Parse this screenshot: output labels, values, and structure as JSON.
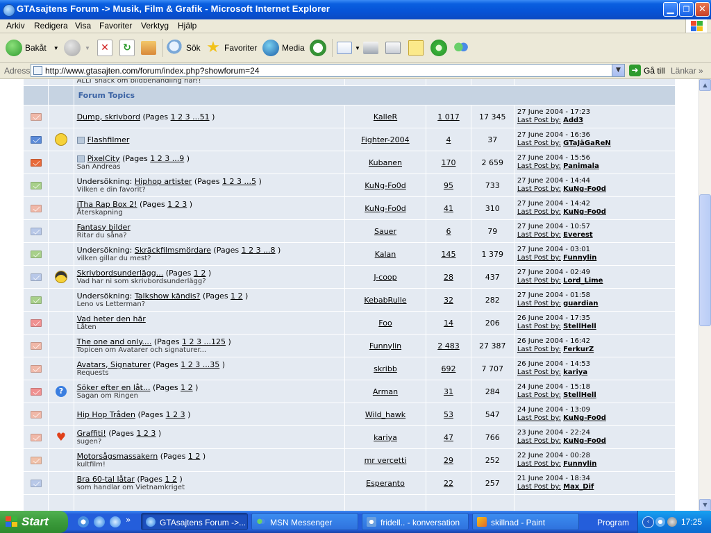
{
  "window": {
    "title": "GTAsajtens Forum -> Musik, Film & Grafik - Microsoft Internet Explorer"
  },
  "menu": [
    "Arkiv",
    "Redigera",
    "Visa",
    "Favoriter",
    "Verktyg",
    "Hjälp"
  ],
  "toolbar": {
    "back": "Bakåt",
    "search": "Sök",
    "favorites": "Favoriter",
    "media": "Media"
  },
  "address": {
    "label": "Adress",
    "url": "http://www.gtasajten.com/forum/index.php?showforum=24",
    "go": "Gå till",
    "links": "Länkar"
  },
  "partial_row": {
    "desc": "ALLT snack om bildbehandling här!!"
  },
  "section": {
    "title": "Forum Topics"
  },
  "topics": [
    {
      "icon_color": "#f0b8a8",
      "emoticon": "",
      "prefix": "",
      "title": "Dump, skrivbord",
      "pages_label": "(Pages",
      "pages": "1 2 3 ...51",
      "desc": "",
      "author": "KalleR",
      "replies": "1 017",
      "views": "17 345",
      "date": "27 June 2004 - 17:23",
      "lp_label": "Last Post by:",
      "lp_user": "Add3"
    },
    {
      "icon_color": "#5a8ad8",
      "emoticon": "smile",
      "prefix": "",
      "title": "Flashfilmer",
      "pages_label": "",
      "pages": "",
      "desc": "",
      "author": "Fighter-2004",
      "replies": "4",
      "views": "37",
      "date": "27 June 2004 - 16:36",
      "lp_label": "Last Post by:",
      "lp_user": "GTaJäGaReN",
      "mini": true
    },
    {
      "icon_color": "#e86a3a",
      "emoticon": "",
      "prefix": "",
      "title": "PixelCity",
      "pages_label": "(Pages",
      "pages": "1 2 3 ...9",
      "desc": "San Andreas",
      "author": "Kubanen",
      "replies": "170",
      "views": "2 659",
      "date": "27 June 2004 - 15:56",
      "lp_label": "Last Post by:",
      "lp_user": "Panimala",
      "mini": true
    },
    {
      "icon_color": "#a8d08a",
      "emoticon": "",
      "prefix": "Undersökning:",
      "title": "Hiphop artister",
      "pages_label": "(Pages",
      "pages": "1 2 3 ...5",
      "desc": "Vilken e din favorit?",
      "author": "KuNg-Fo0d",
      "replies": "95",
      "views": "733",
      "date": "27 June 2004 - 14:44",
      "lp_label": "Last Post by:",
      "lp_user": "KuNg-Fo0d"
    },
    {
      "icon_color": "#f0b8a8",
      "emoticon": "",
      "prefix": "",
      "title": "iTha Rap Box 2!",
      "pages_label": "(Pages",
      "pages": "1 2 3",
      "desc": "Återskapning",
      "author": "KuNg-Fo0d",
      "replies": "41",
      "views": "310",
      "date": "27 June 2004 - 14:42",
      "lp_label": "Last Post by:",
      "lp_user": "KuNg-Fo0d"
    },
    {
      "icon_color": "#b8c8e8",
      "emoticon": "",
      "prefix": "",
      "title": "Fantasy bilder",
      "pages_label": "",
      "pages": "",
      "desc": "Ritar du såna?",
      "author": "Sauer",
      "replies": "6",
      "views": "79",
      "date": "27 June 2004 - 10:57",
      "lp_label": "Last Post by:",
      "lp_user": "Everest"
    },
    {
      "icon_color": "#a8d08a",
      "emoticon": "",
      "prefix": "Undersökning:",
      "title": "Skräckfilmsmördare",
      "pages_label": "(Pages",
      "pages": "1 2 3 ...8",
      "desc": "vilken gillar du mest?",
      "author": "Kalan",
      "replies": "145",
      "views": "1 379",
      "date": "27 June 2004 - 03:01",
      "lp_label": "Last Post by:",
      "lp_user": "Funnylin"
    },
    {
      "icon_color": "#b8c8e8",
      "emoticon": "cool",
      "prefix": "",
      "title": "Skrivbordsunderlägg...",
      "pages_label": "(Pages",
      "pages": "1 2",
      "desc": "Vad har ni som skrivbordsunderlägg?",
      "author": "J-coop",
      "replies": "28",
      "views": "437",
      "date": "27 June 2004 - 02:49",
      "lp_label": "Last Post by:",
      "lp_user": "Lord_Lime"
    },
    {
      "icon_color": "#a8d08a",
      "emoticon": "",
      "prefix": "Undersökning:",
      "title": "Talkshow kändis?",
      "pages_label": "(Pages",
      "pages": "1 2",
      "desc": "Leno vs Letterman?",
      "author": "KebabRulle",
      "replies": "32",
      "views": "282",
      "date": "27 June 2004 - 01:58",
      "lp_label": "Last Post by:",
      "lp_user": "guardian"
    },
    {
      "icon_color": "#f09090",
      "emoticon": "",
      "prefix": "",
      "title": "Vad heter den här",
      "pages_label": "",
      "pages": "",
      "desc": "Låten",
      "author": "Foo",
      "replies": "14",
      "views": "206",
      "date": "26 June 2004 - 17:35",
      "lp_label": "Last Post by:",
      "lp_user": "StellHell"
    },
    {
      "icon_color": "#f0b8a8",
      "emoticon": "",
      "prefix": "",
      "title": "The one and only....",
      "pages_label": "(Pages",
      "pages": "1 2 3 ...125",
      "desc": "Topicen om Avatarer och signaturer...",
      "author": "Funnylin",
      "replies": "2 483",
      "views": "27 387",
      "date": "26 June 2004 - 16:42",
      "lp_label": "Last Post by:",
      "lp_user": "FerkurZ"
    },
    {
      "icon_color": "#f0b8a8",
      "emoticon": "",
      "prefix": "",
      "title": "Avatars, Signaturer",
      "pages_label": "(Pages",
      "pages": "1 2 3 ...35",
      "desc": "Requests",
      "author": "skribb",
      "replies": "692",
      "views": "7 707",
      "date": "26 June 2004 - 14:53",
      "lp_label": "Last Post by:",
      "lp_user": "kariya"
    },
    {
      "icon_color": "#f09090",
      "emoticon": "question",
      "prefix": "",
      "title": "Söker efter en låt...",
      "pages_label": "(Pages",
      "pages": "1 2",
      "desc": "Sagan om Ringen",
      "author": "Arman",
      "replies": "31",
      "views": "284",
      "date": "24 June 2004 - 15:18",
      "lp_label": "Last Post by:",
      "lp_user": "StellHell"
    },
    {
      "icon_color": "#f0b8a8",
      "emoticon": "",
      "prefix": "",
      "title": "Hip Hop Tråden",
      "pages_label": "(Pages",
      "pages": "1 2 3",
      "desc": "",
      "author": "Wild_hawk",
      "replies": "53",
      "views": "547",
      "date": "24 June 2004 - 13:09",
      "lp_label": "Last Post by:",
      "lp_user": "KuNg-Fo0d"
    },
    {
      "icon_color": "#f0b8a8",
      "emoticon": "heart",
      "prefix": "",
      "title": "Graffiti!",
      "pages_label": "(Pages",
      "pages": "1 2 3",
      "desc": "sugen?",
      "author": "kariya",
      "replies": "47",
      "views": "766",
      "date": "23 June 2004 - 22:24",
      "lp_label": "Last Post by:",
      "lp_user": "KuNg-Fo0d"
    },
    {
      "icon_color": "#f0c0a8",
      "emoticon": "",
      "prefix": "",
      "title": "Motorsågsmassakern",
      "pages_label": "(Pages",
      "pages": "1 2",
      "desc": "kultfilm!",
      "author": "mr vercetti",
      "replies": "29",
      "views": "252",
      "date": "22 June 2004 - 00:28",
      "lp_label": "Last Post by:",
      "lp_user": "Funnylin"
    },
    {
      "icon_color": "#b8c8e8",
      "emoticon": "",
      "prefix": "",
      "title": "Bra 60-tal låtar",
      "pages_label": "(Pages",
      "pages": "1 2",
      "desc": "som handlar om Vietnamkriget",
      "author": "Esperanto",
      "replies": "22",
      "views": "257",
      "date": "21 June 2004 - 18:34",
      "lp_label": "Last Post by:",
      "lp_user": "Max_Dif"
    }
  ],
  "taskbar": {
    "start": "Start",
    "tasks": [
      "GTAsajtens Forum ->...",
      "MSN Messenger",
      "fridell.. - konversation",
      "skillnad - Paint"
    ],
    "program": "Program",
    "clock": "17:25"
  }
}
